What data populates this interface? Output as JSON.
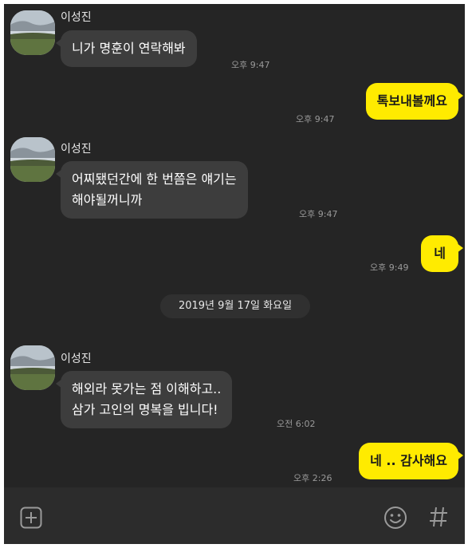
{
  "messages": [
    {
      "sender": "이성진",
      "text_lines": [
        "니가 명훈이 연락해봐"
      ],
      "time": "오후 9:47"
    },
    {
      "text_lines": [
        "톡보내볼께요"
      ],
      "time": "오후 9:47"
    },
    {
      "sender": "이성진",
      "text_lines": [
        "어찌됐던간에 한 번쯤은 얘기는",
        "해야될꺼니까"
      ],
      "time": "오후 9:47"
    },
    {
      "text_lines": [
        "네"
      ],
      "time": "오후 9:49"
    },
    {
      "date": "2019년 9월 17일 화요일"
    },
    {
      "sender": "이성진",
      "text_lines": [
        "해외라 못가는 점 이해하고..",
        "삼가 고인의 명복을 빕니다!"
      ],
      "time": "오전 6:02"
    },
    {
      "text_lines": [
        "네 .. 감사해요"
      ],
      "time": "오후 2:26"
    }
  ],
  "input_bar": {
    "icons": [
      "add-icon",
      "emoji-icon",
      "hashtag-icon"
    ]
  },
  "colors": {
    "background": "#252525",
    "incoming_bubble": "#3d3d3d",
    "outgoing_bubble": "#ffeb00",
    "timestamp": "#9a9a9a"
  }
}
